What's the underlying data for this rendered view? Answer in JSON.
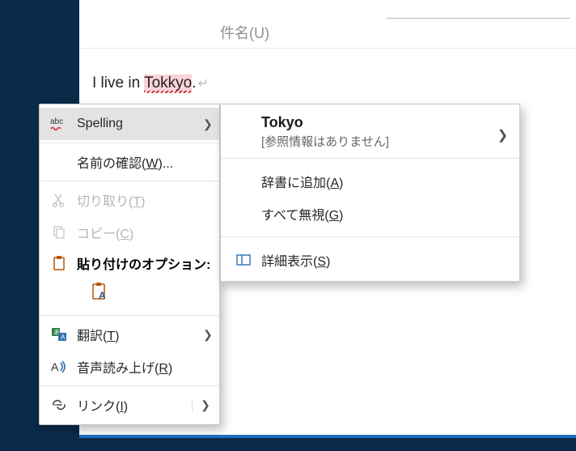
{
  "subject": {
    "placeholder": "件名(U)"
  },
  "message_body": {
    "prefix": "I live in ",
    "misspelled": "Tokkyo",
    "suffix": "."
  },
  "context_menu": {
    "spelling": "Spelling",
    "check_names": "名前の確認(W)...",
    "check_names_mn": "W",
    "cut": "切り取り(T)",
    "cut_mn": "T",
    "copy": "コピー(C)",
    "copy_mn": "C",
    "paste_options": "貼り付けのオプション:",
    "translate": "翻訳(T)",
    "translate_mn": "T",
    "read_aloud": "音声読み上げ(R)",
    "read_aloud_mn": "R",
    "link": "リンク(I)",
    "link_mn": "I"
  },
  "spelling_submenu": {
    "suggestion": "Tokyo",
    "no_reference": "[参照情報はありません]",
    "add_to_dict": "辞書に追加(A)",
    "add_to_dict_mn": "A",
    "ignore_all": "すべて無視(G)",
    "ignore_all_mn": "G",
    "details": "詳細表示(S)",
    "details_mn": "S"
  }
}
